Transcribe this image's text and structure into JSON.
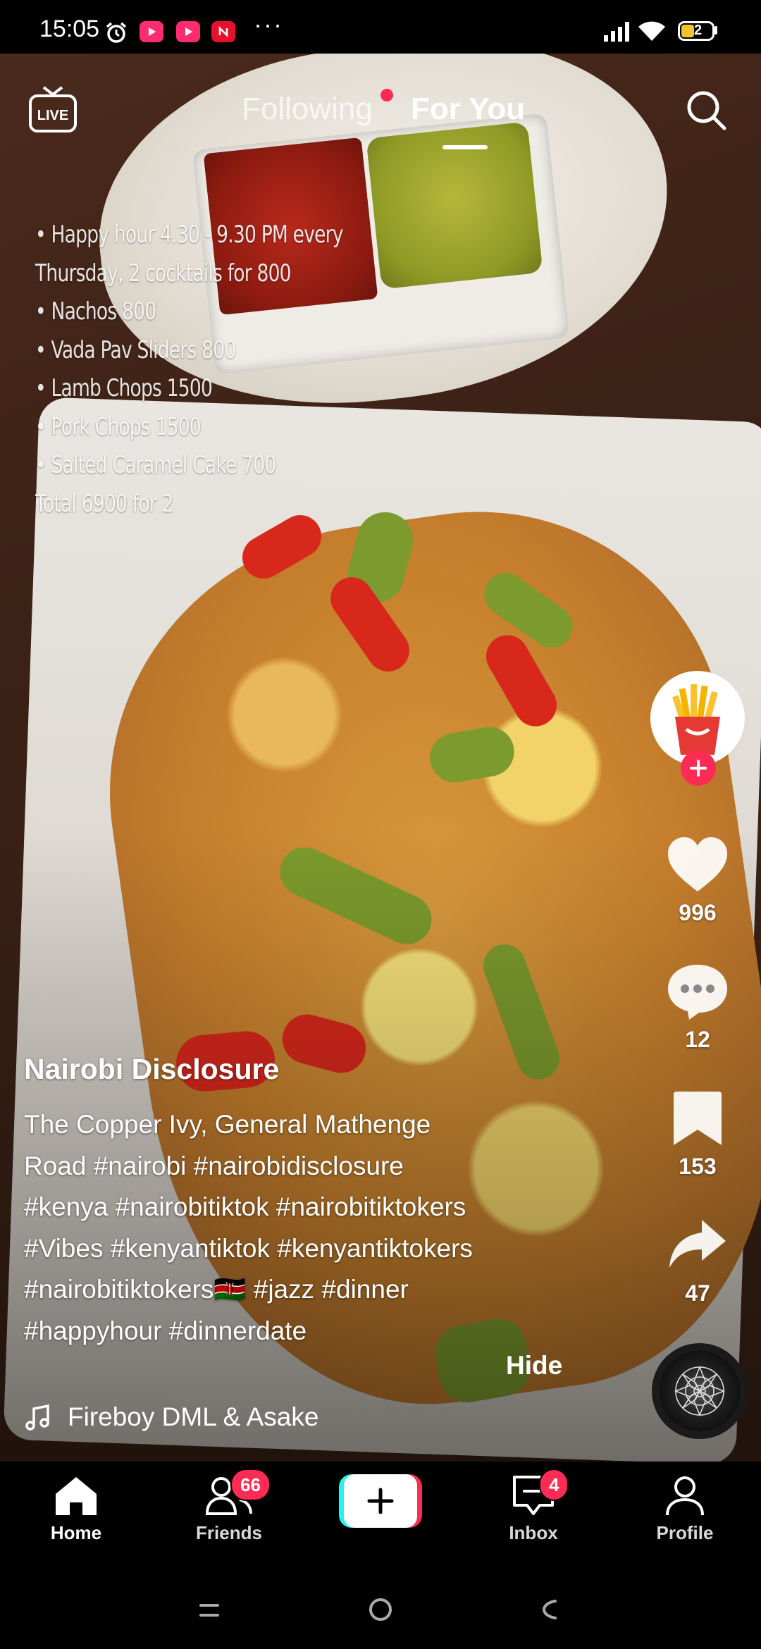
{
  "status_bar": {
    "time": "15:05",
    "overflow": "···",
    "battery_level": "2",
    "icons": [
      "alarm-icon",
      "play-app-icon",
      "play-app-icon",
      "news-app-icon",
      "signal-icon",
      "wifi-icon",
      "battery-icon"
    ]
  },
  "top_nav": {
    "live_label": "LIVE",
    "tabs": [
      {
        "label": "Following",
        "active": false,
        "has_dot": true
      },
      {
        "label": "For You",
        "active": true
      }
    ],
    "search_icon": "search-icon"
  },
  "video_overlay_text": [
    "• Happy hour 4.30 - 9.30 PM every",
    "Thursday, 2 cocktails for 800",
    "• Nachos 800",
    "• Vada Pav Sliders 800",
    "• Lamb Chops 1500",
    "• Pork Chops 1500",
    "• Salted Caramel Cake 700",
    "Total 6900 for 2"
  ],
  "actions": {
    "likes": "996",
    "comments": "12",
    "saves": "153",
    "shares": "47"
  },
  "post": {
    "author": "Nairobi Disclosure",
    "caption_lines": [
      "The Copper Ivy, General Mathenge",
      "Road #nairobi #nairobidisclosure",
      "#kenya #nairobitiktok #nairobitiktokers",
      "#Vibes #kenyantiktok #kenyantiktokers",
      "#nairobitiktokers🇰🇪 #jazz #dinner",
      "#happyhour #dinnerdate"
    ],
    "hide_label": "Hide",
    "music": "Fireboy DML & Asake"
  },
  "bottom_nav": {
    "items": [
      {
        "label": "Home",
        "active": true
      },
      {
        "label": "Friends",
        "badge": "66"
      },
      {
        "label": "",
        "type": "create"
      },
      {
        "label": "Inbox",
        "badge": "4"
      },
      {
        "label": "Profile"
      }
    ]
  },
  "colors": {
    "accent": "#fe2c55",
    "cyan": "#25f4ee",
    "background": "#000000"
  }
}
